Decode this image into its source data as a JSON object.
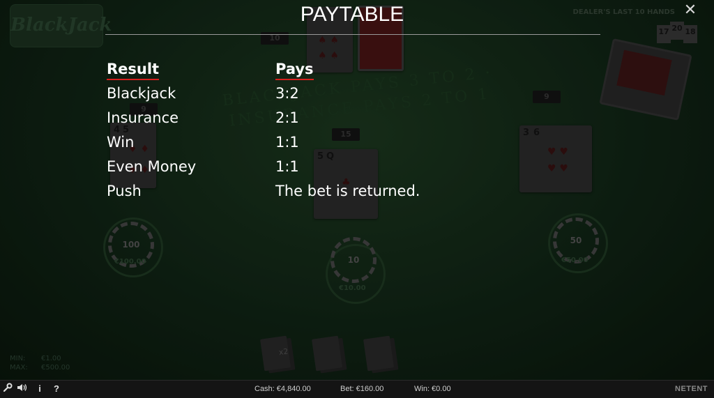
{
  "paytable": {
    "title": "PAYTABLE",
    "headers": {
      "result": "Result",
      "pays": "Pays"
    },
    "rows": [
      {
        "result": "Blackjack",
        "pays": "3:2"
      },
      {
        "result": "Insurance",
        "pays": "2:1"
      },
      {
        "result": "Win",
        "pays": "1:1"
      },
      {
        "result": "Even Money",
        "pays": "1:1"
      },
      {
        "result": "Push",
        "pays": "The bet is returned."
      }
    ],
    "close_icon": "close-icon"
  },
  "game": {
    "logo_text": "BlackJack",
    "felt_text": "BLACKJACK PAYS 3 TO 2 · INSURANCE PAYS 2 TO 1",
    "dealer_history": {
      "label": "DEALER'S LAST 10 HANDS",
      "values": [
        "17",
        "20",
        "18"
      ]
    },
    "dealer_total": "10",
    "hands": [
      {
        "total": "9",
        "cards": [
          "4",
          "5"
        ],
        "chip": "100",
        "bet": "€100.00"
      },
      {
        "total": "15",
        "cards": [
          "5",
          "Q"
        ],
        "chip": "10",
        "bet": "€10.00"
      },
      {
        "total": "9",
        "cards": [
          "3",
          "6"
        ],
        "chip": "50",
        "bet": "€50.00"
      }
    ],
    "actions": {
      "double_label": "x2"
    },
    "limits": {
      "min_label": "MIN:",
      "min_value": "€1.00",
      "max_label": "MAX:",
      "max_value": "€500.00"
    }
  },
  "statusbar": {
    "cash": "Cash: €4,840.00",
    "bet": "Bet: €160.00",
    "win": "Win: €0.00",
    "brand": "NETENT",
    "icons": [
      "wrench-icon",
      "speaker-icon",
      "info-icon",
      "help-icon"
    ]
  }
}
